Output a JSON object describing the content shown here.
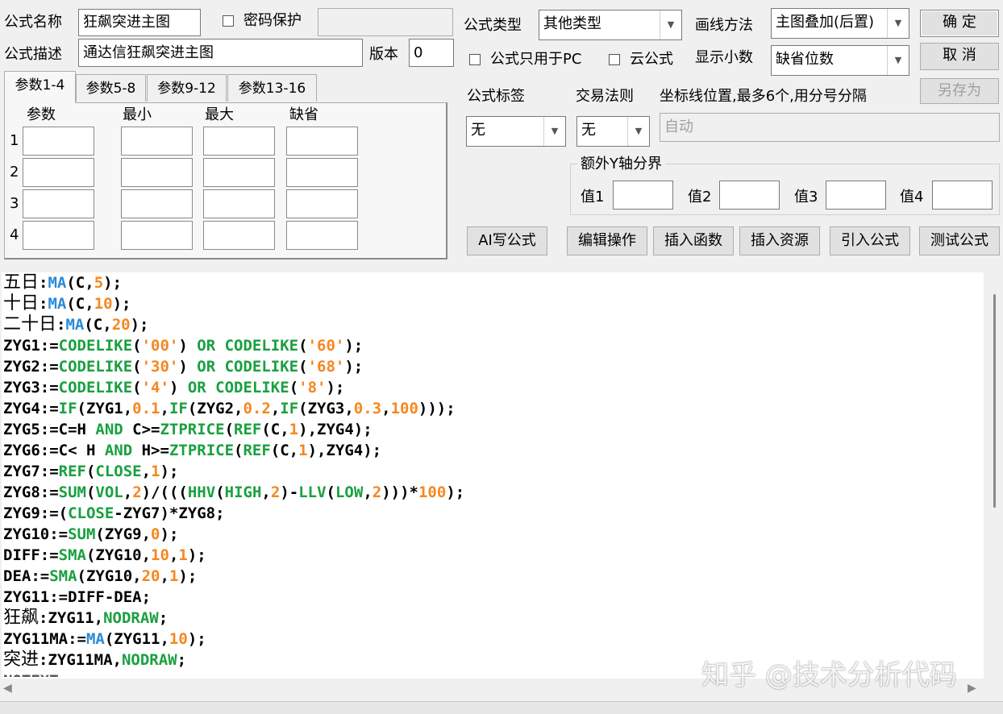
{
  "form": {
    "name_label": "公式名称",
    "name_value": "狂飙突进主图",
    "password_label": "密码保护",
    "password_value": "",
    "desc_label": "公式描述",
    "desc_value": "通达信狂飙突进主图",
    "version_label": "版本",
    "version_value": "0",
    "type_label": "公式类型",
    "type_value": "其他类型",
    "draw_label": "画线方法",
    "draw_value": "主图叠加(后置)",
    "pc_only_label": "公式只用于PC",
    "cloud_label": "云公式",
    "decimals_label": "显示小数",
    "decimals_value": "缺省位数",
    "tag_label": "公式标签",
    "tag_value": "无",
    "rule_label": "交易法则",
    "rule_value": "无",
    "coord_label": "坐标线位置,最多6个,用分号分隔",
    "coord_placeholder": "自动",
    "yaxis_group_label": "额外Y轴分界",
    "val1_label": "值1",
    "val2_label": "值2",
    "val3_label": "值3",
    "val4_label": "值4"
  },
  "buttons": {
    "ok": "确  定",
    "cancel": "取  消",
    "save_as": "另存为",
    "ai": "AI写公式",
    "edit": "编辑操作",
    "insert_func": "插入函数",
    "insert_res": "插入资源",
    "import": "引入公式",
    "test": "测试公式"
  },
  "tabs": [
    "参数1-4",
    "参数5-8",
    "参数9-12",
    "参数13-16"
  ],
  "param_headers": [
    "参数",
    "最小",
    "最大",
    "缺省"
  ],
  "param_rows": [
    "1",
    "2",
    "3",
    "4"
  ],
  "code_lines": [
    [
      [
        "cn",
        "五日"
      ],
      [
        "t",
        ":"
      ],
      [
        "b",
        "MA"
      ],
      [
        "t",
        "(C,"
      ],
      [
        "n",
        "5"
      ],
      [
        "t",
        ");"
      ]
    ],
    [
      [
        "cn",
        "十日"
      ],
      [
        "t",
        ":"
      ],
      [
        "b",
        "MA"
      ],
      [
        "t",
        "(C,"
      ],
      [
        "n",
        "10"
      ],
      [
        "t",
        ");"
      ]
    ],
    [
      [
        "cn",
        "二十日"
      ],
      [
        "t",
        ":"
      ],
      [
        "b",
        "MA"
      ],
      [
        "t",
        "(C,"
      ],
      [
        "n",
        "20"
      ],
      [
        "t",
        ");"
      ]
    ],
    [
      [
        "t",
        "ZYG1:="
      ],
      [
        "g",
        "CODELIKE"
      ],
      [
        "t",
        "("
      ],
      [
        "n",
        "'00'"
      ],
      [
        "t",
        ") "
      ],
      [
        "g",
        "OR"
      ],
      [
        "t",
        " "
      ],
      [
        "g",
        "CODELIKE"
      ],
      [
        "t",
        "("
      ],
      [
        "n",
        "'60'"
      ],
      [
        "t",
        ");"
      ]
    ],
    [
      [
        "t",
        "ZYG2:="
      ],
      [
        "g",
        "CODELIKE"
      ],
      [
        "t",
        "("
      ],
      [
        "n",
        "'30'"
      ],
      [
        "t",
        ") "
      ],
      [
        "g",
        "OR"
      ],
      [
        "t",
        " "
      ],
      [
        "g",
        "CODELIKE"
      ],
      [
        "t",
        "("
      ],
      [
        "n",
        "'68'"
      ],
      [
        "t",
        ");"
      ]
    ],
    [
      [
        "t",
        "ZYG3:="
      ],
      [
        "g",
        "CODELIKE"
      ],
      [
        "t",
        "("
      ],
      [
        "n",
        "'4'"
      ],
      [
        "t",
        ") "
      ],
      [
        "g",
        "OR"
      ],
      [
        "t",
        " "
      ],
      [
        "g",
        "CODELIKE"
      ],
      [
        "t",
        "("
      ],
      [
        "n",
        "'8'"
      ],
      [
        "t",
        ");"
      ]
    ],
    [
      [
        "t",
        "ZYG4:="
      ],
      [
        "g",
        "IF"
      ],
      [
        "t",
        "(ZYG1,"
      ],
      [
        "n",
        "0.1"
      ],
      [
        "t",
        ","
      ],
      [
        "g",
        "IF"
      ],
      [
        "t",
        "(ZYG2,"
      ],
      [
        "n",
        "0.2"
      ],
      [
        "t",
        ","
      ],
      [
        "g",
        "IF"
      ],
      [
        "t",
        "(ZYG3,"
      ],
      [
        "n",
        "0.3"
      ],
      [
        "t",
        ","
      ],
      [
        "n",
        "100"
      ],
      [
        "t",
        ")));"
      ]
    ],
    [
      [
        "t",
        "ZYG5:=C=H "
      ],
      [
        "g",
        "AND"
      ],
      [
        "t",
        " C>="
      ],
      [
        "g",
        "ZTPRICE"
      ],
      [
        "t",
        "("
      ],
      [
        "g",
        "REF"
      ],
      [
        "t",
        "(C,"
      ],
      [
        "n",
        "1"
      ],
      [
        "t",
        "),ZYG4);"
      ]
    ],
    [
      [
        "t",
        "ZYG6:=C< H "
      ],
      [
        "g",
        "AND"
      ],
      [
        "t",
        " H>="
      ],
      [
        "g",
        "ZTPRICE"
      ],
      [
        "t",
        "("
      ],
      [
        "g",
        "REF"
      ],
      [
        "t",
        "(C,"
      ],
      [
        "n",
        "1"
      ],
      [
        "t",
        "),ZYG4);"
      ]
    ],
    [
      [
        "t",
        "ZYG7:="
      ],
      [
        "g",
        "REF"
      ],
      [
        "t",
        "("
      ],
      [
        "g",
        "CLOSE"
      ],
      [
        "t",
        ","
      ],
      [
        "n",
        "1"
      ],
      [
        "t",
        ");"
      ]
    ],
    [
      [
        "t",
        "ZYG8:="
      ],
      [
        "g",
        "SUM"
      ],
      [
        "t",
        "("
      ],
      [
        "g",
        "VOL"
      ],
      [
        "t",
        ","
      ],
      [
        "n",
        "2"
      ],
      [
        "t",
        ")/((("
      ],
      [
        "g",
        "HHV"
      ],
      [
        "t",
        "("
      ],
      [
        "g",
        "HIGH"
      ],
      [
        "t",
        ","
      ],
      [
        "n",
        "2"
      ],
      [
        "t",
        ")-"
      ],
      [
        "g",
        "LLV"
      ],
      [
        "t",
        "("
      ],
      [
        "g",
        "LOW"
      ],
      [
        "t",
        ","
      ],
      [
        "n",
        "2"
      ],
      [
        "t",
        ")))*"
      ],
      [
        "n",
        "100"
      ],
      [
        "t",
        ");"
      ]
    ],
    [
      [
        "t",
        "ZYG9:=("
      ],
      [
        "g",
        "CLOSE"
      ],
      [
        "t",
        "-ZYG7)*ZYG8;"
      ]
    ],
    [
      [
        "t",
        "ZYG10:="
      ],
      [
        "g",
        "SUM"
      ],
      [
        "t",
        "(ZYG9,"
      ],
      [
        "n",
        "0"
      ],
      [
        "t",
        ");"
      ]
    ],
    [
      [
        "t",
        "DIFF:="
      ],
      [
        "g",
        "SMA"
      ],
      [
        "t",
        "(ZYG10,"
      ],
      [
        "n",
        "10"
      ],
      [
        "t",
        ","
      ],
      [
        "n",
        "1"
      ],
      [
        "t",
        ");"
      ]
    ],
    [
      [
        "t",
        "DEA:="
      ],
      [
        "g",
        "SMA"
      ],
      [
        "t",
        "(ZYG10,"
      ],
      [
        "n",
        "20"
      ],
      [
        "t",
        ","
      ],
      [
        "n",
        "1"
      ],
      [
        "t",
        ");"
      ]
    ],
    [
      [
        "t",
        "ZYG11:=DIFF-DEA;"
      ]
    ],
    [
      [
        "cn",
        "狂飙"
      ],
      [
        "t",
        ":ZYG11,"
      ],
      [
        "g",
        "NODRAW"
      ],
      [
        "t",
        ";"
      ]
    ],
    [
      [
        "t",
        "ZYG11MA:="
      ],
      [
        "b",
        "MA"
      ],
      [
        "t",
        "(ZYG11,"
      ],
      [
        "n",
        "10"
      ],
      [
        "t",
        ");"
      ]
    ],
    [
      [
        "cn",
        "突进"
      ],
      [
        "t",
        ":ZYG11MA,"
      ],
      [
        "g",
        "NODRAW"
      ],
      [
        "t",
        ";"
      ]
    ]
  ],
  "watermark": "知乎 @技术分析代码"
}
